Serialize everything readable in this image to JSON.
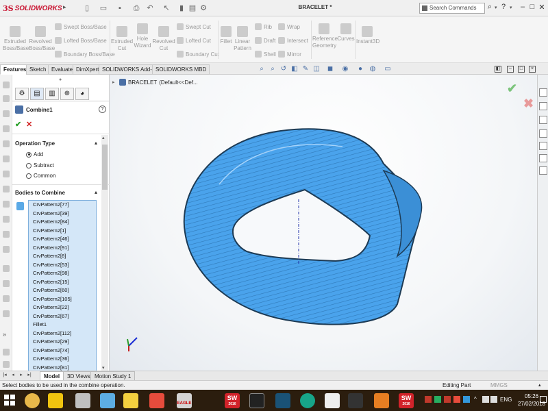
{
  "app": {
    "brand": "SOLIDWORKS",
    "brand_prefix": "3S",
    "doc_title": "BRACELET *"
  },
  "search": {
    "value": "Search Commands"
  },
  "ribbon": {
    "items": [
      {
        "label1": "Extruded",
        "label2": "Boss/Base"
      },
      {
        "label1": "Revolved",
        "label2": "Boss/Base"
      },
      {
        "label": "Swept Boss/Base"
      },
      {
        "label": "Lofted Boss/Base"
      },
      {
        "label": "Boundary Boss/Base"
      },
      {
        "label1": "Extruded",
        "label2": "Cut"
      },
      {
        "label1": "Hole",
        "label2": "Wizard"
      },
      {
        "label1": "Revolved",
        "label2": "Cut"
      },
      {
        "label": "Swept Cut"
      },
      {
        "label": "Lofted Cut"
      },
      {
        "label": "Boundary Cut"
      },
      {
        "label": "Fillet"
      },
      {
        "label1": "Linear",
        "label2": "Pattern"
      },
      {
        "label": "Rib"
      },
      {
        "label": "Draft"
      },
      {
        "label": "Shell"
      },
      {
        "label": "Wrap"
      },
      {
        "label": "Intersect"
      },
      {
        "label": "Mirror"
      },
      {
        "label1": "Reference",
        "label2": "Geometry"
      },
      {
        "label": "Curves"
      },
      {
        "label": "Instant3D"
      }
    ]
  },
  "tabs": [
    "Features",
    "Sketch",
    "Evaluate",
    "DimXpert",
    "SOLIDWORKS Add-Ins",
    "SOLIDWORKS MBD"
  ],
  "property_manager": {
    "title": "Combine1",
    "operation_type": {
      "title": "Operation Type",
      "options": [
        {
          "label": "Add",
          "selected": true
        },
        {
          "label": "Subtract",
          "selected": false
        },
        {
          "label": "Common",
          "selected": false
        }
      ]
    },
    "bodies": {
      "title": "Bodies to Combine",
      "items": [
        "CrvPattern2[77]",
        "CrvPattern2[39]",
        "CrvPattern2[84]",
        "CrvPattern2[1]",
        "CrvPattern2[46]",
        "CrvPattern2[91]",
        "CrvPattern2[8]",
        "CrvPattern2[53]",
        "CrvPattern2[98]",
        "CrvPattern2[15]",
        "CrvPattern2[60]",
        "CrvPattern2[105]",
        "CrvPattern2[22]",
        "CrvPattern2[67]",
        "Fillet1",
        "CrvPattern2[112]",
        "CrvPattern2[29]",
        "CrvPattern2[74]",
        "CrvPattern2[36]",
        "CrvPattern2[81]"
      ]
    }
  },
  "graphics": {
    "tree_label": "BRACELET",
    "tree_config": "(Default<<Def..."
  },
  "bottom_tabs": [
    "Model",
    "3D Views",
    "Motion Study 1"
  ],
  "status": {
    "message": "Select bodies to be used in the combine operation.",
    "mode": "Editing Part",
    "units": "MMGS"
  },
  "taskbar": {
    "lang": "ENG",
    "time": "05:26",
    "date": "27/02/2018",
    "sw_label": "SW",
    "sw_year": "2016",
    "eagle_label": "EAGLE"
  },
  "colors": {
    "body_blue": "#3d9be9",
    "brand_red": "#c8102e",
    "taskbar": "#2b1d0e"
  }
}
